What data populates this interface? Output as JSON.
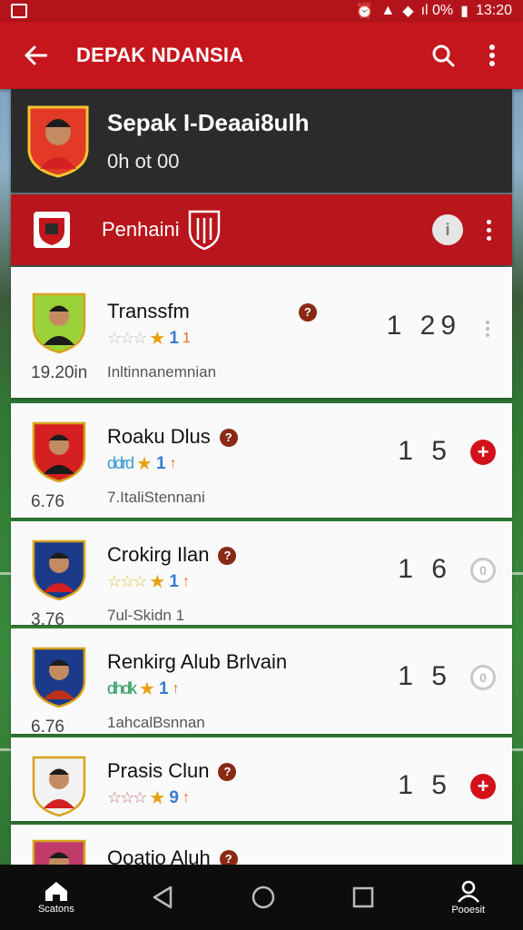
{
  "status_bar": {
    "network": "ıl 0%",
    "time": "13:20"
  },
  "app_bar": {
    "title": "DEPAK NDANSIA"
  },
  "profile": {
    "name": "Sepak I-Deaai8ulh",
    "subtitle": "0h ot 00"
  },
  "section": {
    "label": "Penhaini",
    "info_symbol": "i"
  },
  "clubs": [
    {
      "name": "Transsfm",
      "stars": "☆☆☆",
      "rating": "1",
      "rating2": "1",
      "value": "19.20in",
      "desc": "Inltinnanemnian",
      "score": "1 29",
      "action": "dots",
      "has_badge": true
    },
    {
      "name": "Roaku Dlus",
      "stars": "ddrd",
      "rating": "1",
      "rating2": "↑",
      "value": "6.76",
      "desc": "7.ItaliStennani",
      "score": "1 5",
      "action": "add",
      "has_badge": true
    },
    {
      "name": "Crokirg Ilan",
      "stars": "☆☆☆",
      "rating": "1",
      "rating2": "↑",
      "value": "3.76",
      "desc": "7ul-Skidn     1",
      "score": "1 6",
      "action": "toggle",
      "has_badge": true
    },
    {
      "name": "Renkirg Alub Brlvain",
      "stars": "dhdk",
      "rating": "1",
      "rating2": "↑",
      "value": "6.76",
      "desc": "1ahcalBsnnan",
      "score": "1 5",
      "action": "toggle",
      "has_badge": false
    },
    {
      "name": "Prasis Clun",
      "stars": "☆☆☆",
      "rating": "9",
      "rating2": "↑",
      "value": "",
      "desc": "",
      "score": "1 5",
      "action": "add",
      "has_badge": true
    },
    {
      "name": "Ooatio Aluh",
      "stars": "",
      "rating": "",
      "rating2": "",
      "value": "",
      "desc": "",
      "score": "",
      "action": "",
      "has_badge": true
    }
  ],
  "nav": {
    "left_label": "Scatons",
    "right_label": "Pooesit"
  },
  "colors": {
    "primary": "#c5161d",
    "dark_card": "#2b2b2b",
    "accent_red": "#d3111b"
  }
}
